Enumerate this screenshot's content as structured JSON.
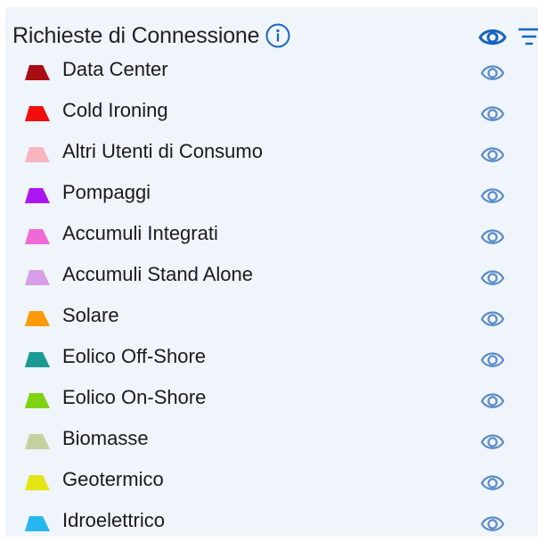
{
  "header": {
    "title": "Richieste di Connessione",
    "info_icon": "info-circle-icon",
    "visibility_icon": "eye-icon",
    "filter_icon": "filter-icon"
  },
  "colors": {
    "panel_background": "#f0f4fb",
    "icon_blue": "#1565c0",
    "icon_blue_light": "#5a8cc8"
  },
  "layers": [
    {
      "label": "Data Center",
      "color": "#a80d12"
    },
    {
      "label": "Cold Ironing",
      "color": "#f20d0d"
    },
    {
      "label": "Altri Utenti di Consumo",
      "color": "#f7b6bd"
    },
    {
      "label": "Pompaggi",
      "color": "#aa16f0"
    },
    {
      "label": "Accumuli Integrati",
      "color": "#f06ad5"
    },
    {
      "label": "Accumuli Stand Alone",
      "color": "#d89ee8"
    },
    {
      "label": "Solare",
      "color": "#fb9b0c"
    },
    {
      "label": "Eolico Off-Shore",
      "color": "#1a9a92"
    },
    {
      "label": "Eolico On-Shore",
      "color": "#7fd312"
    },
    {
      "label": "Biomasse",
      "color": "#c6d29e"
    },
    {
      "label": "Geotermico",
      "color": "#e3e514"
    },
    {
      "label": "Idroelettrico",
      "color": "#26b7f0"
    }
  ]
}
